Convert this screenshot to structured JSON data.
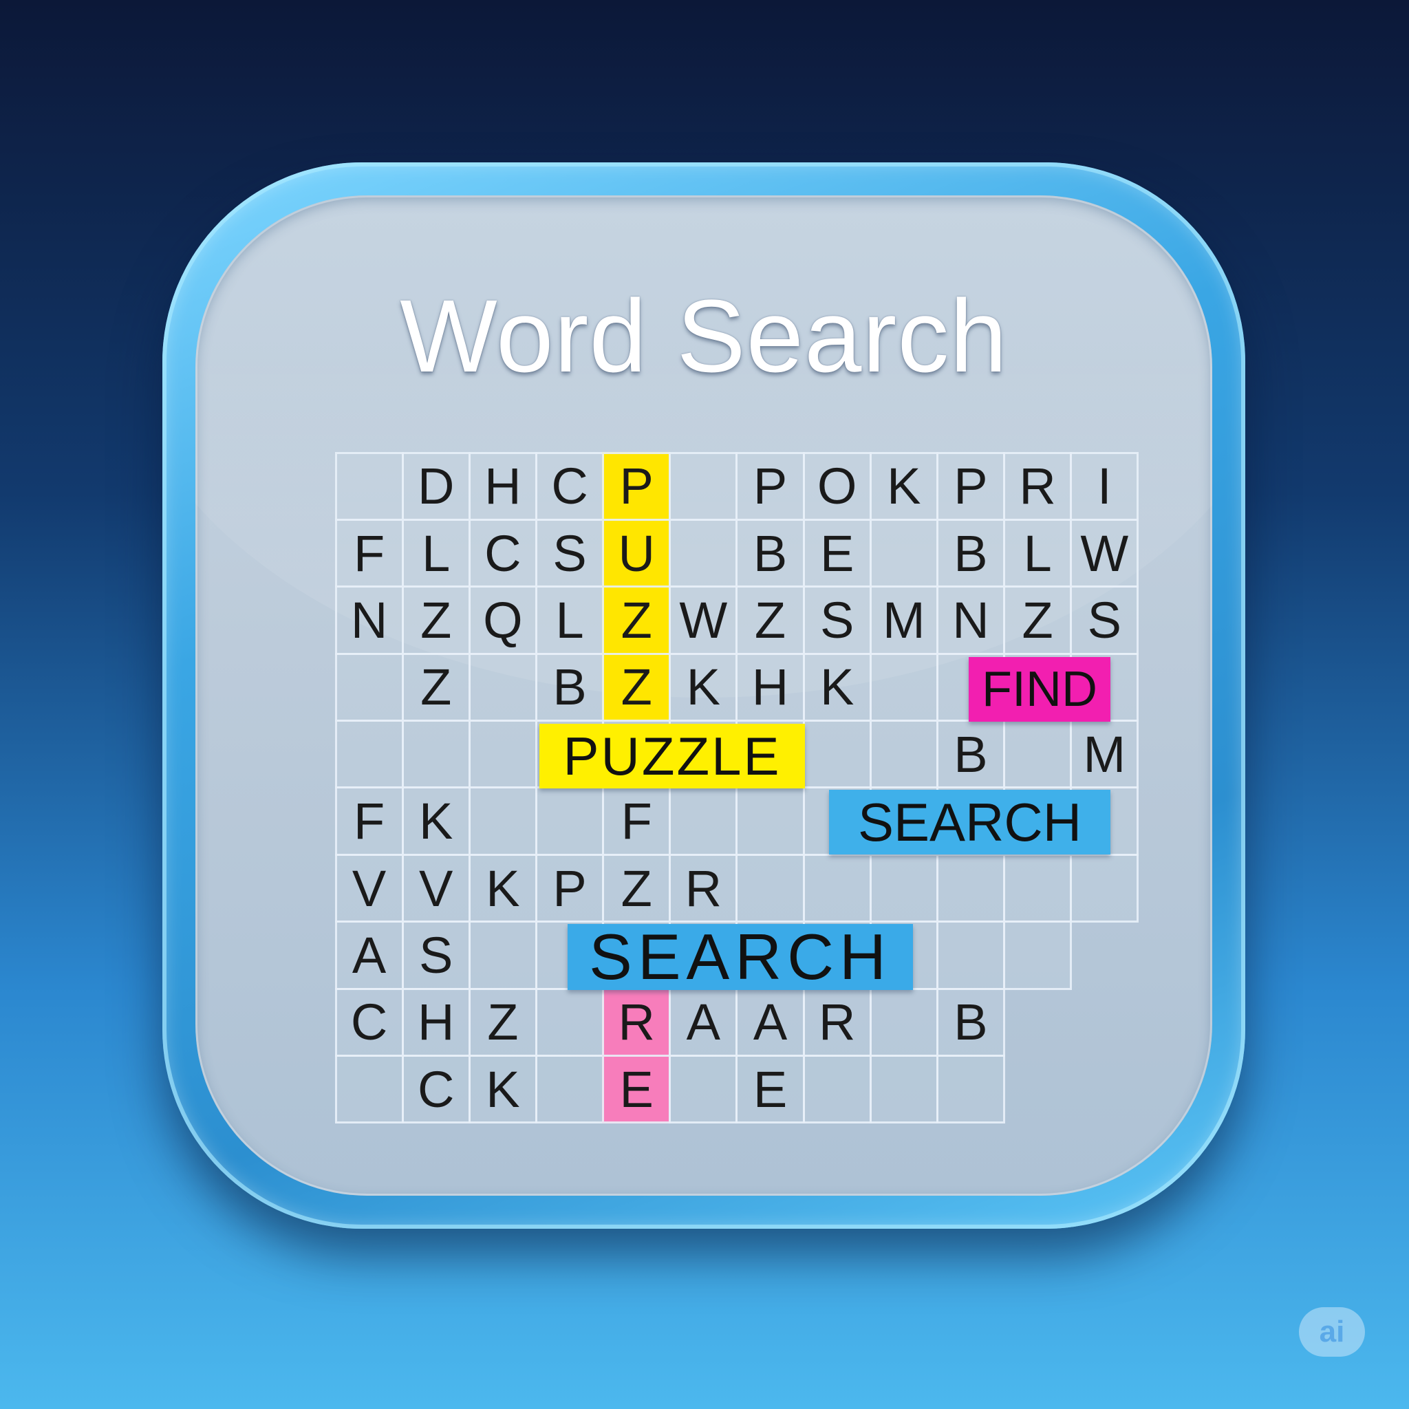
{
  "title": "Word Search",
  "grid": {
    "rows": [
      [
        "",
        "D",
        "H",
        "C",
        "P",
        "",
        "P",
        "O",
        "K",
        "P",
        "R",
        "I"
      ],
      [
        "F",
        "L",
        "C",
        "S",
        "U",
        "",
        "B",
        "E",
        "",
        "B",
        "L",
        "W"
      ],
      [
        "N",
        "Z",
        "Q",
        "L",
        "Z",
        "W",
        "Z",
        "S",
        "M",
        "N",
        "Z",
        "S"
      ],
      [
        "",
        "Z",
        "",
        "B",
        "Z",
        "K",
        "H",
        "K",
        "",
        "",
        "",
        ""
      ],
      [
        "",
        "",
        "",
        "",
        "",
        "",
        "",
        "",
        "",
        "B",
        "",
        "M"
      ],
      [
        "F",
        "K",
        "",
        "",
        "F",
        "",
        "",
        "",
        "",
        "",
        "",
        ""
      ],
      [
        "V",
        "V",
        "K",
        "P",
        "Z",
        "R",
        "",
        "",
        "",
        "",
        "",
        ""
      ],
      [
        "A",
        "S",
        "",
        "",
        "",
        "",
        "",
        "",
        "",
        "",
        "",
        ""
      ],
      [
        "C",
        "H",
        "Z",
        "",
        "R",
        "A",
        "A",
        "R",
        "",
        "B",
        "",
        ""
      ],
      [
        "",
        "C",
        "K",
        "",
        "E",
        "",
        "E",
        "",
        "",
        "",
        "",
        ""
      ]
    ],
    "highlight_colors": {
      "yellow": "#ffe600",
      "pink": "#f77dbb"
    },
    "highlighted_cells": {
      "yellow": [
        [
          0,
          4
        ],
        [
          1,
          4
        ],
        [
          2,
          4
        ],
        [
          3,
          4
        ]
      ],
      "pink": [
        [
          8,
          4
        ],
        [
          9,
          4
        ]
      ]
    },
    "missing_cells": [
      [
        7,
        11
      ],
      [
        8,
        10
      ],
      [
        8,
        11
      ],
      [
        9,
        10
      ],
      [
        9,
        11
      ]
    ]
  },
  "found_words": {
    "puzzle": {
      "label": "PUZZLE",
      "color": "#fff000"
    },
    "find": {
      "label": "FIND",
      "color": "#f21fb0"
    },
    "search_right": {
      "label": "SEARCH",
      "color": "#3fb0ea"
    },
    "search_big": {
      "label": "SEARCH",
      "color": "#3aaae8"
    }
  },
  "badge": {
    "label": "ai",
    "icon": "ai-watermark-icon"
  }
}
